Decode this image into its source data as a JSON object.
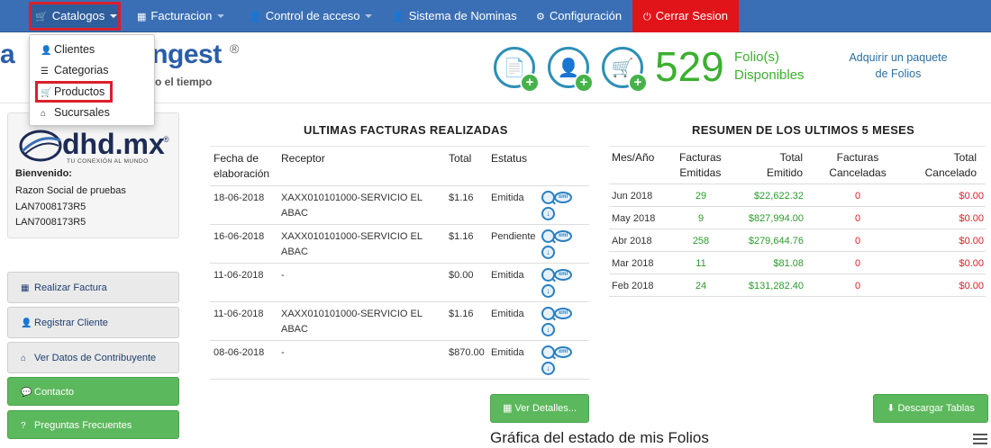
{
  "nav": {
    "catalogos": "Catalogos",
    "facturacion": "Facturacion",
    "control": "Control de acceso",
    "nominas": "Sistema de Nominas",
    "config": "Configuración",
    "logout": "Cerrar Sesion"
  },
  "dropdown": [
    "Clientes",
    "Categorias",
    "Productos",
    "Sucursales"
  ],
  "header": {
    "brand_left": "a",
    "brand_right": "ngest",
    "reg": "®",
    "tagline": "o el tiempo",
    "folio_count": "529",
    "folio_label_1": "Folio(s)",
    "folio_label_2": "Disponibles",
    "buy_link_1": "Adquirir un paquete",
    "buy_link_2": "de Folios"
  },
  "profile": {
    "logo_text": "dhd.mx",
    "logo_reg": "®",
    "logo_sub": "TU CONEXIÓN AL MUNDO",
    "welcome": "Bienvenido:",
    "razon": "Razon Social de pruebas",
    "rfc1": "LAN7008173R5",
    "rfc2": "LAN7008173R5"
  },
  "side_buttons": {
    "realizar": "Realizar Factura",
    "registrar": "Registrar Cliente",
    "ver_datos": "Ver Datos de Contribuyente",
    "contacto": "Contacto",
    "preguntas": "Preguntas Frecuentes"
  },
  "invoices": {
    "title": "ULTIMAS FACTURAS REALIZADAS",
    "headers": {
      "fecha_1": "Fecha de",
      "fecha_2": "elaboración",
      "receptor": "Receptor",
      "total": "Total",
      "estatus": "Estatus"
    },
    "xml_label": "xml",
    "rows": [
      {
        "fecha": "18-06-2018",
        "receptor_1": "XAXX010101000-SERVICIO EL",
        "receptor_2": "ABAC",
        "total": "$1.16",
        "estatus": "Emitida"
      },
      {
        "fecha": "16-06-2018",
        "receptor_1": "XAXX010101000-SERVICIO EL",
        "receptor_2": "ABAC",
        "total": "$1.16",
        "estatus": "Pendiente"
      },
      {
        "fecha": "11-06-2018",
        "receptor_1": "-",
        "receptor_2": "",
        "total": "$0.00",
        "estatus": "Emitida"
      },
      {
        "fecha": "11-06-2018",
        "receptor_1": "XAXX010101000-SERVICIO EL",
        "receptor_2": "ABAC",
        "total": "$1.16",
        "estatus": "Emitida"
      },
      {
        "fecha": "08-06-2018",
        "receptor_1": "-",
        "receptor_2": "",
        "total": "$870.00",
        "estatus": "Emitida"
      }
    ],
    "details_button": "Ver Detalles..."
  },
  "summary": {
    "title": "RESUMEN DE LOS ULTIMOS 5 MESES",
    "headers": {
      "mes": "Mes/Año",
      "fe_1": "Facturas",
      "fe_2": "Emitidas",
      "te_1": "Total",
      "te_2": "Emitido",
      "fc_1": "Facturas",
      "fc_2": "Canceladas",
      "tc_1": "Total",
      "tc_2": "Cancelado"
    },
    "rows": [
      {
        "mes": "Jun 2018",
        "emitidas": "29",
        "total_emitido": "$22,622.32",
        "canceladas": "0",
        "total_cancelado": "$0.00"
      },
      {
        "mes": "May 2018",
        "emitidas": "9",
        "total_emitido": "$827,994.00",
        "canceladas": "0",
        "total_cancelado": "$0.00"
      },
      {
        "mes": "Abr 2018",
        "emitidas": "258",
        "total_emitido": "$279,644.76",
        "canceladas": "0",
        "total_cancelado": "$0.00"
      },
      {
        "mes": "Mar 2018",
        "emitidas": "11",
        "total_emitido": "$81.08",
        "canceladas": "0",
        "total_cancelado": "$0.00"
      },
      {
        "mes": "Feb 2018",
        "emitidas": "24",
        "total_emitido": "$131,282.40",
        "canceladas": "0",
        "total_cancelado": "$0.00"
      }
    ],
    "download_button": "Descargar Tablas"
  },
  "chart_title": "Gráfica del estado de mis Folios",
  "colors": {
    "navbar": "#3a6fb5",
    "logout": "#e01419",
    "highlight": "#d9202b",
    "folio_green": "#3bb02f",
    "button_green": "#5cb85c"
  }
}
